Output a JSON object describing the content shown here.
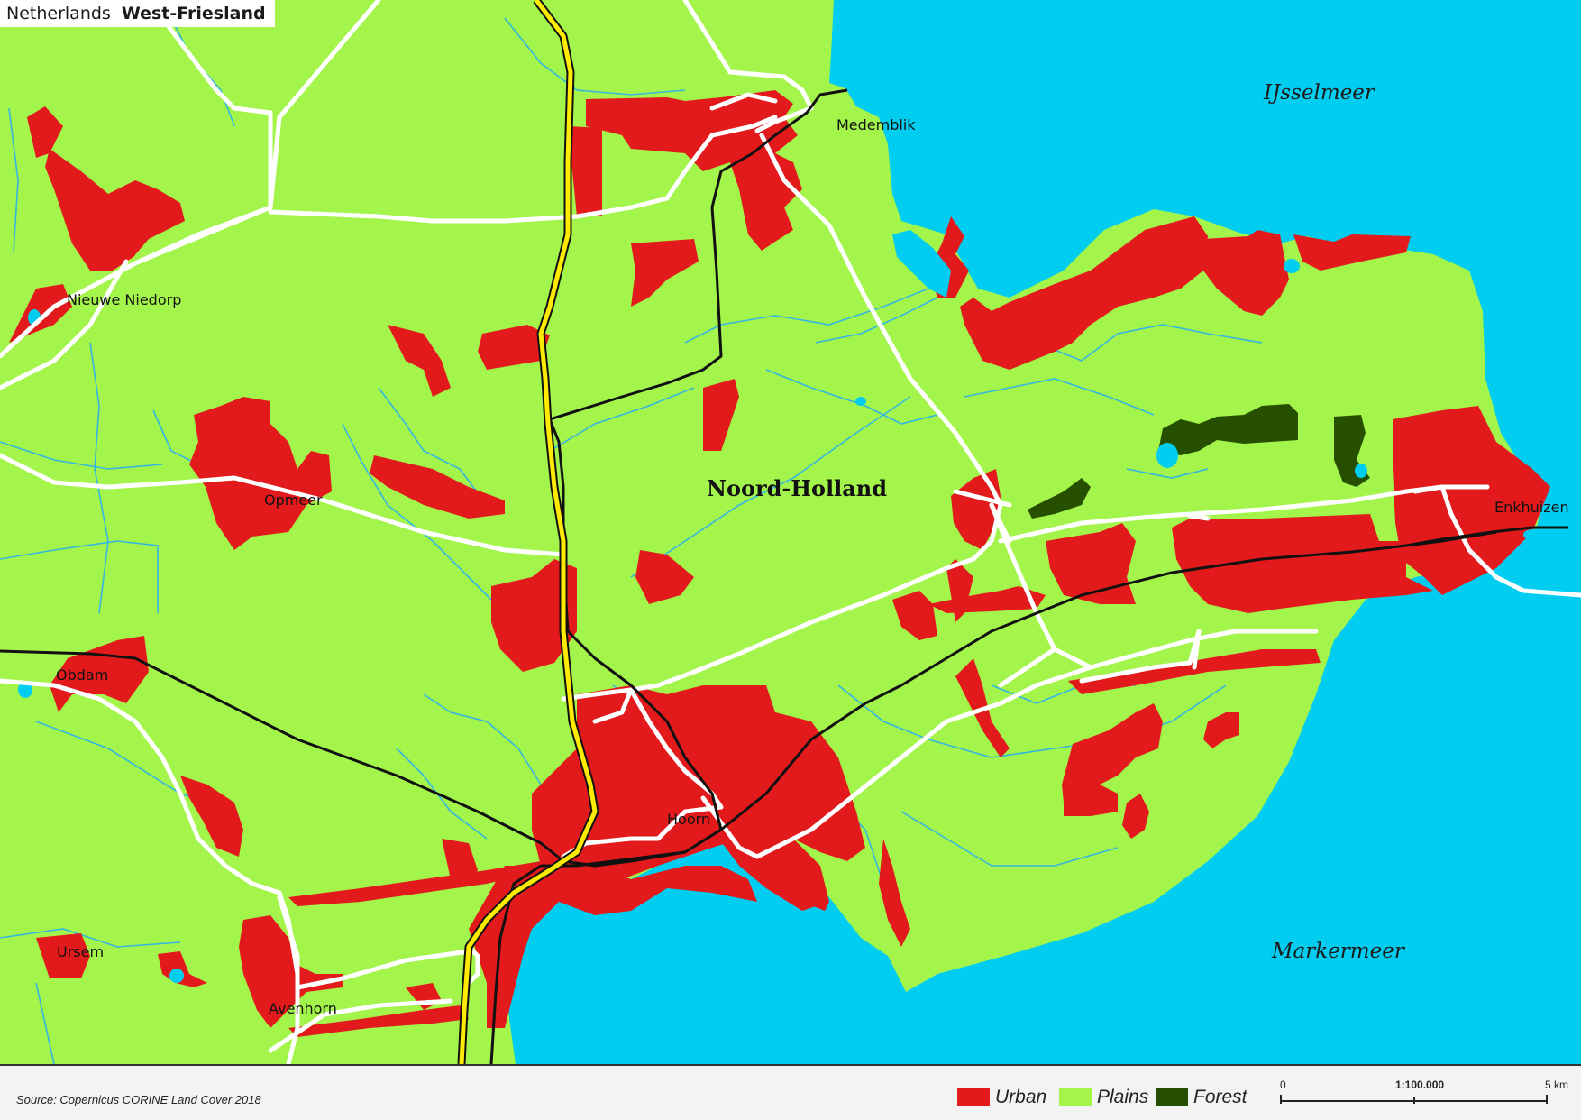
{
  "title": {
    "country": "Netherlands",
    "region": "West-Friesland"
  },
  "map": {
    "province_label": "Noord-Holland",
    "water_labels": {
      "ijsselmeer": "IJsselmeer",
      "markermeer": "Markermeer"
    },
    "places": {
      "medemblik": "Medemblik",
      "nieuwe_niedorp": "Nieuwe Niedorp",
      "opmeer": "Opmeer",
      "obdam": "Obdam",
      "hoorn": "Hoorn",
      "ursem": "Ursem",
      "avenhorn": "Avenhorn",
      "enkhuizen": "Enkhuizen"
    },
    "colors": {
      "water": "#00cdf0",
      "plains": "#a3f54b",
      "urban": "#e31a1c",
      "forest": "#274f00",
      "road": "#ffffff",
      "motorway": "#ffeb00",
      "railway": "#111111",
      "stream": "#34b6e0"
    }
  },
  "legend": {
    "urban": "Urban",
    "plains": "Plains",
    "forest": "Forest"
  },
  "scale": {
    "start": "0",
    "ratio": "1:100.000",
    "end": "5 km"
  },
  "source": "Source: Copernicus CORINE Land Cover 2018"
}
